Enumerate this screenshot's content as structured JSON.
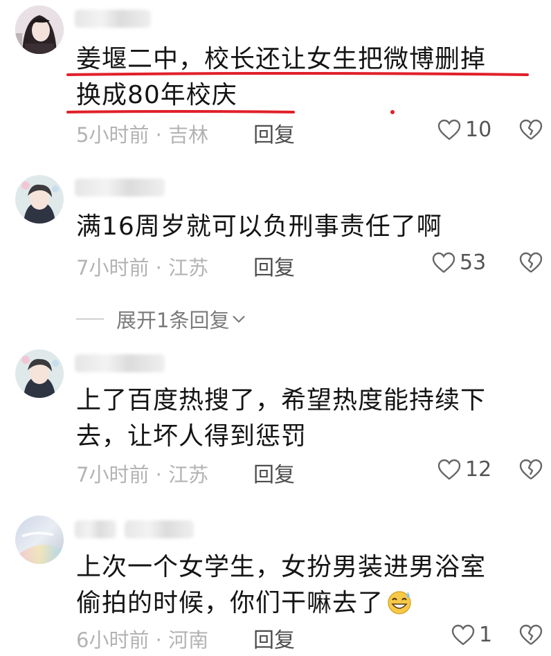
{
  "comments": [
    {
      "text_line1": "姜堰二中，校长还让女生把微博删掉",
      "text_line2": "换成80年校庆",
      "time_location": "5小时前 · 吉林",
      "reply_label": "回复",
      "likes": "10"
    },
    {
      "text_line1": "满16周岁就可以负刑事责任了啊",
      "time_location": "7小时前 · 江苏",
      "reply_label": "回复",
      "likes": "53"
    },
    {
      "text_line1": "上了百度热搜了，希望热度能持续下",
      "text_line2": "去，让坏人得到惩罚",
      "time_location": "7小时前 · 江苏",
      "reply_label": "回复",
      "likes": "12"
    },
    {
      "text_line1": "上次一个女学生，女扮男装进男浴室",
      "text_line2": "偷拍的时候，你们干嘛去了",
      "time_location": "6小时前 · 河南",
      "reply_label": "回复",
      "likes": "1"
    }
  ],
  "expand_replies_label": "展开1条回复",
  "icons": {
    "like": "heart-outline-icon",
    "dislike": "broken-heart-icon",
    "expand": "chevron-down-icon",
    "emoji": "grinning-sweat-emoji"
  },
  "colors": {
    "annotation_underline": "#e0202a",
    "meta_text": "#b3b3b3",
    "body_text": "#141414"
  }
}
